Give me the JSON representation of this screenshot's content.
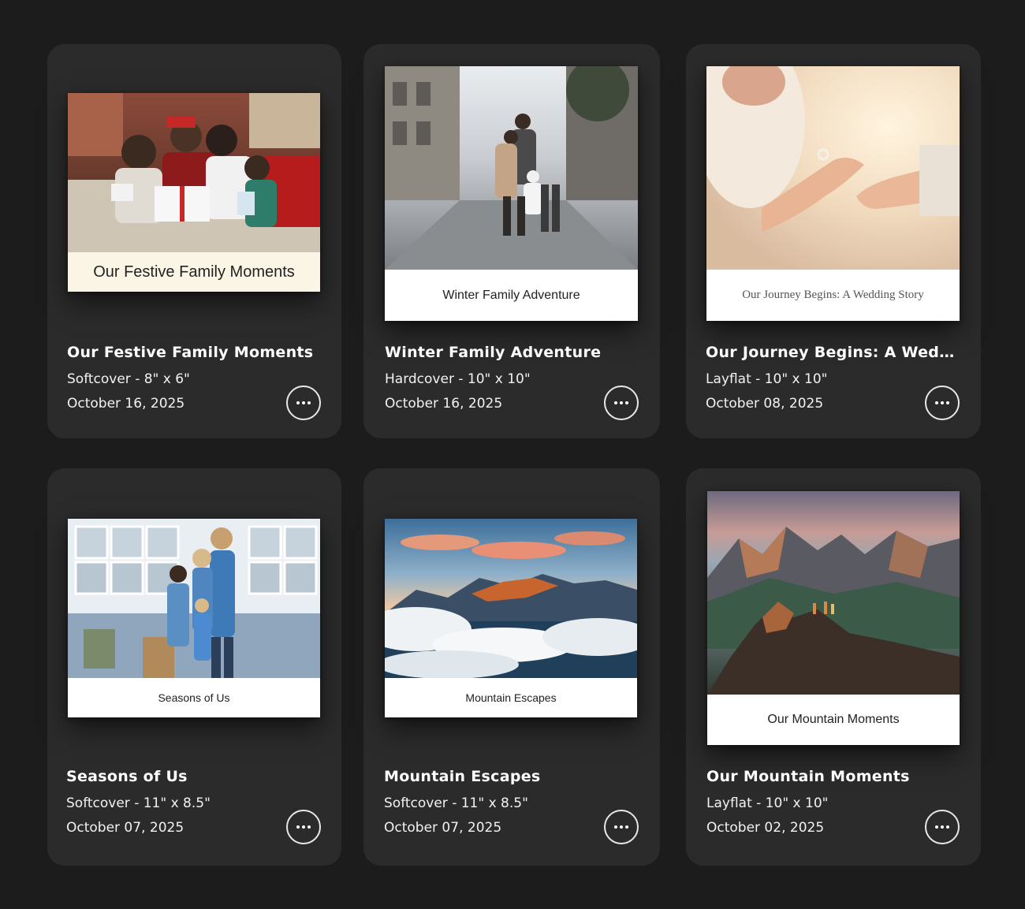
{
  "projects": [
    {
      "cover_caption": "Our Festive Family Moments",
      "title": "Our Festive Family Moments",
      "spec": "Softcover - 8\" x 6\"",
      "date": "October 16, 2025",
      "photo_icon": "family-christmas-photo"
    },
    {
      "cover_caption": "Winter Family Adventure",
      "title": "Winter Family Adventure",
      "spec": "Hardcover - 10\" x 10\"",
      "date": "October 16, 2025",
      "photo_icon": "snowy-street-family-photo"
    },
    {
      "cover_caption": "Our Journey Begins: A Wedding Story",
      "title": "Our Journey Begins: A Wedd...",
      "spec": "Layflat - 10\" x 10\"",
      "date": "October 08, 2025",
      "photo_icon": "holding-hands-ring-photo"
    },
    {
      "cover_caption": "Seasons of Us",
      "title": "Seasons of Us",
      "spec": "Softcover - 11\" x 8.5\"",
      "date": "October 07, 2025",
      "photo_icon": "family-porch-photo"
    },
    {
      "cover_caption": "Mountain Escapes",
      "title": "Mountain Escapes",
      "spec": "Softcover - 11\" x 8.5\"",
      "date": "October 07, 2025",
      "photo_icon": "mountains-clouds-photo"
    },
    {
      "cover_caption": "Our Mountain Moments",
      "title": "Our Mountain Moments",
      "spec": "Layflat - 10\" x 10\"",
      "date": "October 02, 2025",
      "photo_icon": "mountain-peak-hikers-photo"
    }
  ],
  "colors": {
    "page_background": "#1c1c1c",
    "card_background": "#2b2b2b",
    "festive_caption_background": "#fbf5e6"
  }
}
